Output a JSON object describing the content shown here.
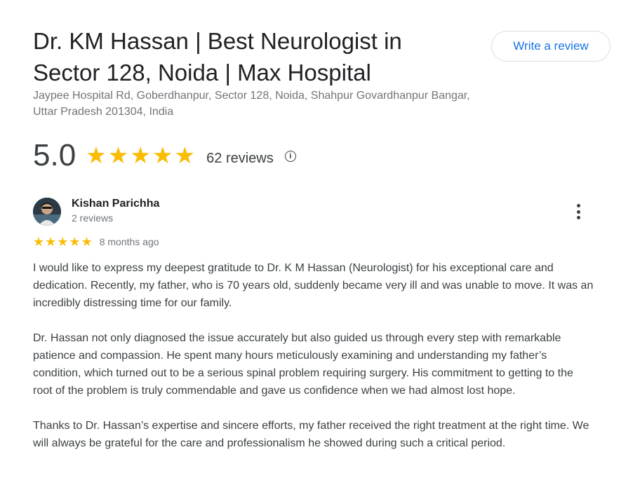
{
  "business": {
    "title": "Dr. KM Hassan | Best Neurologist in Sector 128, Noida | Max Hospital",
    "address": "Jaypee Hospital Rd, Goberdhanpur, Sector 128, Noida, Shahpur Govardhanpur Bangar, Uttar Pradesh 201304, India",
    "write_review_label": "Write a review"
  },
  "rating": {
    "value": "5.0",
    "stars": [
      "★",
      "★",
      "★",
      "★",
      "★"
    ],
    "review_count": "62 reviews",
    "info_icon": "i"
  },
  "review": {
    "reviewer_name": "Kishan Parichha",
    "reviewer_reviews": "2 reviews",
    "stars": [
      "★",
      "★",
      "★",
      "★",
      "★"
    ],
    "time_ago": "8 months ago",
    "paragraphs": [
      "I would like to express my deepest gratitude to Dr. K M Hassan (Neurologist) for his exceptional care and dedication. Recently, my father, who is 70 years old, suddenly became very ill and was unable to move. It was an incredibly distressing time for our family.",
      "Dr. Hassan not only diagnosed the issue accurately but also guided us through every step with remarkable patience and compassion. He spent many hours meticulously examining and understanding my father’s condition, which turned out to be a serious spinal problem requiring surgery. His commitment to getting to the root of the problem is truly commendable and gave us confidence when we had almost lost hope.",
      "Thanks to Dr. Hassan’s expertise and sincere efforts, my father received the right treatment at the right time. We will always be grateful for the care and professionalism he showed during such a critical period."
    ]
  },
  "colors": {
    "star": "#fbbc04",
    "link": "#1a73e8",
    "secondary_text": "#70757a"
  }
}
